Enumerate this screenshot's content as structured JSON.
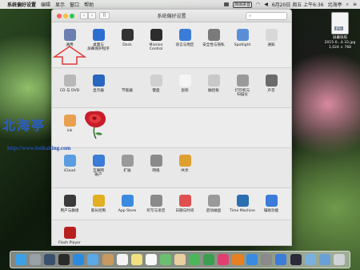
{
  "menubar": {
    "app_name": "系统偏好设置",
    "menus": [
      "编辑",
      "显示",
      "窗口",
      "帮助"
    ],
    "ime": "简体拼音",
    "date_time": "6月20日 周五 上午6:36",
    "user": "北海亭"
  },
  "desktop_file": {
    "badge": "JPG",
    "name_line1": "屏幕快照",
    "name_line2": "2015-0...4.33.jpg",
    "name_line3": "1,024 × 768"
  },
  "window": {
    "title": "系统偏好设置",
    "search_placeholder": ""
  },
  "panes": {
    "row1": [
      {
        "label": "通用",
        "color": "#6a7fb0",
        "icon": "file-icon"
      },
      {
        "label": "桌面与\n屏幕保护程序",
        "color": "#2a6fd0",
        "icon": "desktop-icon"
      },
      {
        "label": "Dock",
        "color": "#333333",
        "icon": "dock-icon"
      },
      {
        "label": "Mission\nControl",
        "color": "#2c2c2c",
        "icon": "mission-control-icon"
      },
      {
        "label": "语言与地区",
        "color": "#3a7cd8",
        "icon": "flag-icon"
      },
      {
        "label": "安全性与隐私",
        "color": "#7a7a7a",
        "icon": "house-lock-icon"
      },
      {
        "label": "Spotlight",
        "color": "#5a8fd8",
        "icon": "spotlight-icon"
      },
      {
        "label": "通知",
        "color": "#d8d8d8",
        "icon": "notifications-icon"
      }
    ],
    "row2": [
      {
        "label": "CD 与 DVD",
        "color": "#b8b8b8",
        "icon": "cd-icon"
      },
      {
        "label": "显示器",
        "color": "#2a66c0",
        "icon": "display-icon"
      },
      {
        "label": "节能器",
        "color": "#e8e8e8",
        "icon": "bulb-icon"
      },
      {
        "label": "键盘",
        "color": "#d0d0d0",
        "icon": "keyboard-icon"
      },
      {
        "label": "鼠标",
        "color": "#f4f4f4",
        "icon": "mouse-icon"
      },
      {
        "label": "触控板",
        "color": "#c8c8c8",
        "icon": "trackpad-icon"
      },
      {
        "label": "打印机与\n扫描仪",
        "color": "#9a9a9a",
        "icon": "printer-icon"
      },
      {
        "label": "声音",
        "color": "#6a6a6a",
        "icon": "speaker-icon"
      }
    ],
    "row3": [
      {
        "label": "ink",
        "color": "#e8a050",
        "icon": "ink-icon"
      }
    ],
    "row4": [
      {
        "label": "iCloud",
        "color": "#5a9de0",
        "icon": "icloud-icon"
      },
      {
        "label": "互联网\n账户",
        "color": "#3a7cd8",
        "icon": "at-icon"
      },
      {
        "label": "扩展",
        "color": "#9a9a9a",
        "icon": "puzzle-icon"
      },
      {
        "label": "网络",
        "color": "#8a8a8a",
        "icon": "globe-icon"
      },
      {
        "label": "共享",
        "color": "#e0a030",
        "icon": "sharing-icon"
      }
    ],
    "row5": [
      {
        "label": "用户与群组",
        "color": "#3a3a3a",
        "icon": "users-icon"
      },
      {
        "label": "家长控制",
        "color": "#e0b020",
        "icon": "parental-icon"
      },
      {
        "label": "App Store",
        "color": "#3a8be0",
        "icon": "appstore-icon"
      },
      {
        "label": "听写与语音",
        "color": "#8a8a8a",
        "icon": "microphone-icon"
      },
      {
        "label": "日期与时间",
        "color": "#e05050",
        "icon": "clock-icon"
      },
      {
        "label": "启动磁盘",
        "color": "#9a9a9a",
        "icon": "disk-icon"
      },
      {
        "label": "Time Machine",
        "color": "#2a6fb0",
        "icon": "time-machine-icon"
      },
      {
        "label": "辅助功能",
        "color": "#3a7cd8",
        "icon": "accessibility-icon"
      }
    ],
    "row6": [
      {
        "label": "Flash Player",
        "color": "#b82020",
        "icon": "flash-icon"
      }
    ]
  },
  "watermark": {
    "text": "北海亭",
    "url": "http://www.beihaiting.com"
  },
  "dock": [
    {
      "name": "finder-icon",
      "color": "#3aa0e8"
    },
    {
      "name": "launchpad-icon",
      "color": "#9aa0a8"
    },
    {
      "name": "mission-control-icon",
      "color": "#3a5070"
    },
    {
      "name": "dashboard-icon",
      "color": "#2a2a2a"
    },
    {
      "name": "safari-icon",
      "color": "#2a8ae0"
    },
    {
      "name": "mail-icon",
      "color": "#5aa8e8"
    },
    {
      "name": "contacts-icon",
      "color": "#c89a60"
    },
    {
      "name": "calendar-icon",
      "color": "#f4f4f4"
    },
    {
      "name": "notes-icon",
      "color": "#f0e080"
    },
    {
      "name": "reminders-icon",
      "color": "#f8f8f8"
    },
    {
      "name": "maps-icon",
      "color": "#6ac070"
    },
    {
      "name": "photos-icon",
      "color": "#e8d0a0"
    },
    {
      "name": "messages-icon",
      "color": "#4ab85a"
    },
    {
      "name": "facetime-icon",
      "color": "#3aa050"
    },
    {
      "name": "itunes-icon",
      "color": "#e04070"
    },
    {
      "name": "ibooks-icon",
      "color": "#e88020"
    },
    {
      "name": "app-store-icon",
      "color": "#3a8be0"
    },
    {
      "name": "system-preferences-icon",
      "color": "#8a8a8a"
    },
    {
      "name": "keynote-icon",
      "color": "#3a7cd8"
    },
    {
      "name": "quicktime-icon",
      "color": "#2a2a3a"
    },
    {
      "name": "folder-icon",
      "color": "#7ab0e0"
    },
    {
      "name": "downloads-icon",
      "color": "#6aa0d8"
    },
    {
      "name": "trash-icon",
      "color": "#d0d4d8"
    }
  ]
}
